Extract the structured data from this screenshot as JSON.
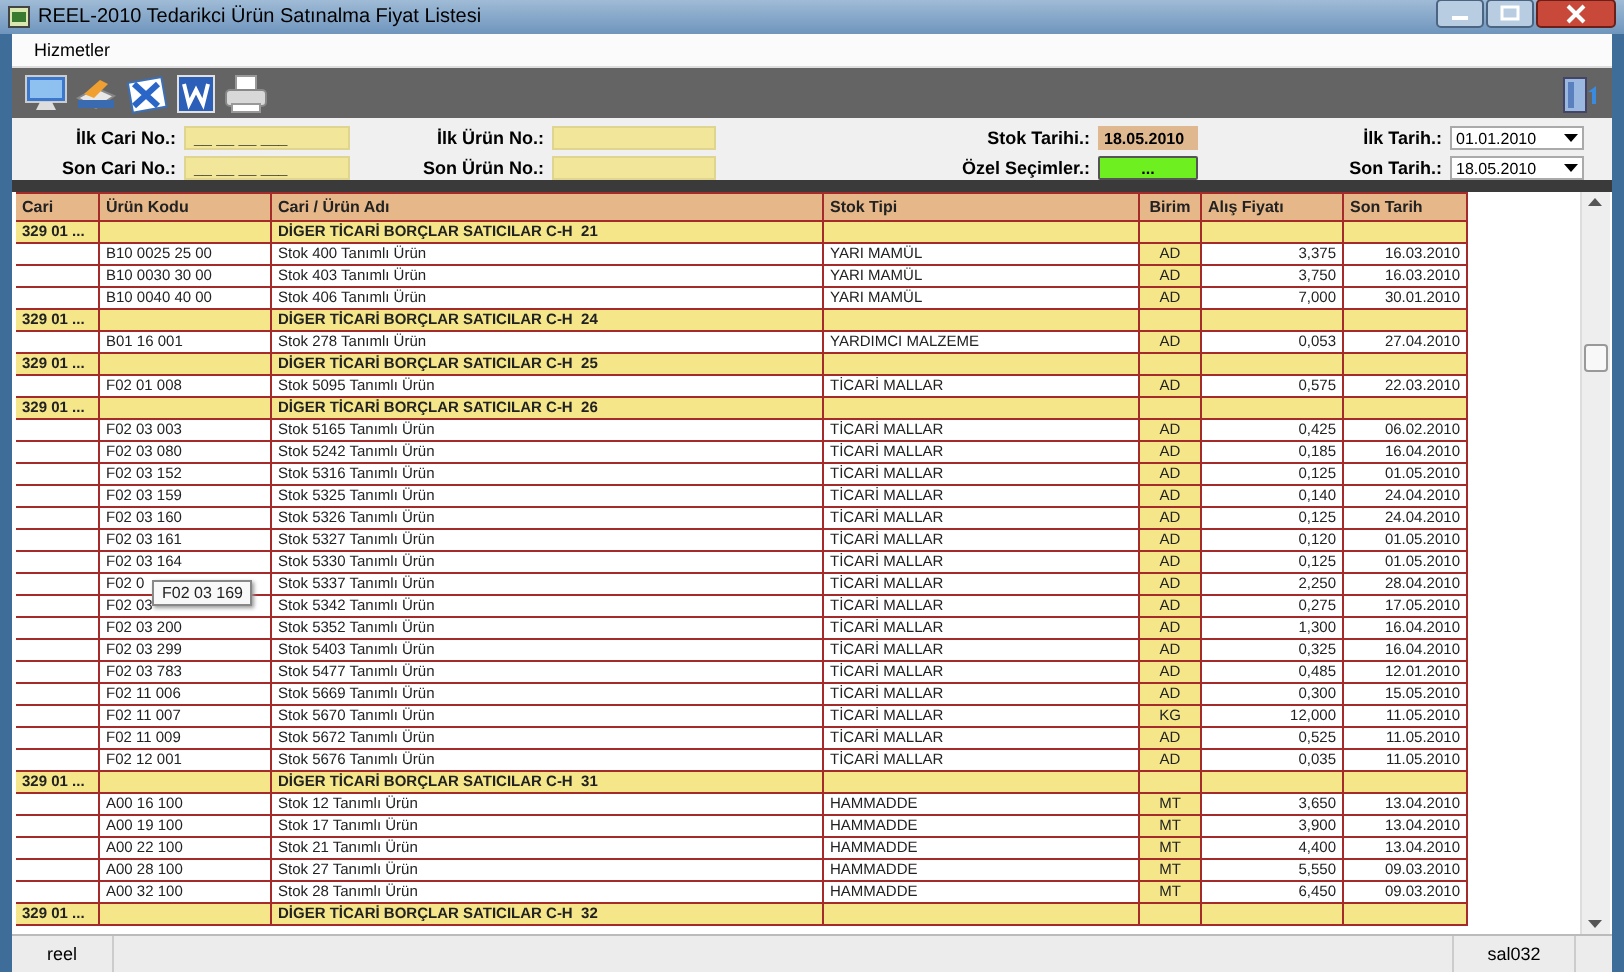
{
  "window": {
    "title": "REEL-2010 Tedarikci Ürün Satınalma Fiyat Listesi"
  },
  "menu": [
    "Hizmetler"
  ],
  "filters": {
    "left": [
      {
        "label": "İlk Cari No.:",
        "value": "__ __ __ ___"
      },
      {
        "label": "Son Cari No.:",
        "value": "__ __ __ ___"
      }
    ],
    "middle": [
      {
        "label": "İlk Ürün No.:"
      },
      {
        "label": "Son Ürün No.:"
      }
    ],
    "stock_date": {
      "label": "Stok Tarihi.:",
      "value": "18.05.2010"
    },
    "special": {
      "label": "Özel Seçimler.:",
      "button": "..."
    },
    "dates": [
      {
        "label": "İlk Tarih.:",
        "value": "01.01.2010"
      },
      {
        "label": "Son Tarih.:",
        "value": "18.05.2010"
      }
    ]
  },
  "table": {
    "columns": [
      "Cari",
      "Ürün Kodu",
      "Cari / Ürün Adı",
      "Stok Tipi",
      "Birim",
      "Alış Fiyatı",
      "Son Tarih"
    ],
    "rows": [
      {
        "kind": "group",
        "cari": "329 01 ...",
        "name": "DİGER TİCARİ BORÇLAR SATICILAR C-H  21"
      },
      {
        "kind": "item",
        "code": "B10 0025 25 00",
        "name": "Stok 400 Tanımlı Ürün",
        "type": "YARI MAMÜL",
        "unit": "AD",
        "price": "3,375",
        "date": "16.03.2010"
      },
      {
        "kind": "item",
        "code": "B10 0030 30 00",
        "name": "Stok 403 Tanımlı Ürün",
        "type": "YARI MAMÜL",
        "unit": "AD",
        "price": "3,750",
        "date": "16.03.2010"
      },
      {
        "kind": "item",
        "code": "B10 0040 40 00",
        "name": "Stok 406 Tanımlı Ürün",
        "type": "YARI MAMÜL",
        "unit": "AD",
        "price": "7,000",
        "date": "30.01.2010"
      },
      {
        "kind": "group",
        "cari": "329 01 ...",
        "name": "DİGER TİCARİ BORÇLAR SATICILAR C-H  24"
      },
      {
        "kind": "item",
        "code": "B01 16 001",
        "name": "Stok 278 Tanımlı Ürün",
        "type": "YARDIMCI MALZEME",
        "unit": "AD",
        "price": "0,053",
        "date": "27.04.2010"
      },
      {
        "kind": "group",
        "cari": "329 01 ...",
        "name": "DİGER TİCARİ BORÇLAR SATICILAR C-H  25"
      },
      {
        "kind": "item",
        "code": "F02 01 008",
        "name": "Stok 5095 Tanımlı Ürün",
        "type": "TİCARİ MALLAR",
        "unit": "AD",
        "price": "0,575",
        "date": "22.03.2010"
      },
      {
        "kind": "group",
        "cari": "329 01 ...",
        "name": "DİGER TİCARİ BORÇLAR SATICILAR C-H  26"
      },
      {
        "kind": "item",
        "code": "F02 03 003",
        "name": "Stok 5165 Tanımlı Ürün",
        "type": "TİCARİ MALLAR",
        "unit": "AD",
        "price": "0,425",
        "date": "06.02.2010"
      },
      {
        "kind": "item",
        "code": "F02 03 080",
        "name": "Stok 5242 Tanımlı Ürün",
        "type": "TİCARİ MALLAR",
        "unit": "AD",
        "price": "0,185",
        "date": "16.04.2010"
      },
      {
        "kind": "item",
        "code": "F02 03 152",
        "name": "Stok 5316 Tanımlı Ürün",
        "type": "TİCARİ MALLAR",
        "unit": "AD",
        "price": "0,125",
        "date": "01.05.2010"
      },
      {
        "kind": "item",
        "code": "F02 03 159",
        "name": "Stok 5325 Tanımlı Ürün",
        "type": "TİCARİ MALLAR",
        "unit": "AD",
        "price": "0,140",
        "date": "24.04.2010"
      },
      {
        "kind": "item",
        "code": "F02 03 160",
        "name": "Stok 5326 Tanımlı Ürün",
        "type": "TİCARİ MALLAR",
        "unit": "AD",
        "price": "0,125",
        "date": "24.04.2010"
      },
      {
        "kind": "item",
        "code": "F02 03 161",
        "name": "Stok 5327 Tanımlı Ürün",
        "type": "TİCARİ MALLAR",
        "unit": "AD",
        "price": "0,120",
        "date": "01.05.2010"
      },
      {
        "kind": "item",
        "code": "F02 03 164",
        "name": "Stok 5330 Tanımlı Ürün",
        "type": "TİCARİ MALLAR",
        "unit": "AD",
        "price": "0,125",
        "date": "01.05.2010"
      },
      {
        "kind": "item",
        "code": "F02 0",
        "name": "Stok 5337 Tanımlı Ürün",
        "type": "TİCARİ MALLAR",
        "unit": "AD",
        "price": "2,250",
        "date": "28.04.2010",
        "tooltip": "F02 03 169"
      },
      {
        "kind": "item",
        "code": "F02 03",
        "name": "Stok 5342 Tanımlı Ürün",
        "type": "TİCARİ MALLAR",
        "unit": "AD",
        "price": "0,275",
        "date": "17.05.2010"
      },
      {
        "kind": "item",
        "code": "F02 03 200",
        "name": "Stok 5352 Tanımlı Ürün",
        "type": "TİCARİ MALLAR",
        "unit": "AD",
        "price": "1,300",
        "date": "16.04.2010"
      },
      {
        "kind": "item",
        "code": "F02 03 299",
        "name": "Stok 5403 Tanımlı Ürün",
        "type": "TİCARİ MALLAR",
        "unit": "AD",
        "price": "0,325",
        "date": "16.04.2010"
      },
      {
        "kind": "item",
        "code": "F02 03 783",
        "name": "Stok 5477 Tanımlı Ürün",
        "type": "TİCARİ MALLAR",
        "unit": "AD",
        "price": "0,485",
        "date": "12.01.2010"
      },
      {
        "kind": "item",
        "code": "F02 11 006",
        "name": "Stok 5669 Tanımlı Ürün",
        "type": "TİCARİ MALLAR",
        "unit": "AD",
        "price": "0,300",
        "date": "15.05.2010"
      },
      {
        "kind": "item",
        "code": "F02 11 007",
        "name": "Stok 5670 Tanımlı Ürün",
        "type": "TİCARİ MALLAR",
        "unit": "KG",
        "price": "12,000",
        "date": "11.05.2010"
      },
      {
        "kind": "item",
        "code": "F02 11 009",
        "name": "Stok 5672 Tanımlı Ürün",
        "type": "TİCARİ MALLAR",
        "unit": "AD",
        "price": "0,525",
        "date": "11.05.2010"
      },
      {
        "kind": "item",
        "code": "F02 12 001",
        "name": "Stok 5676 Tanımlı Ürün",
        "type": "TİCARİ MALLAR",
        "unit": "AD",
        "price": "0,035",
        "date": "11.05.2010"
      },
      {
        "kind": "group",
        "cari": "329 01 ...",
        "name": "DİGER TİCARİ BORÇLAR SATICILAR C-H  31"
      },
      {
        "kind": "item",
        "code": "A00 16 100",
        "name": "Stok 12 Tanımlı Ürün",
        "type": "HAMMADDE",
        "unit": "MT",
        "price": "3,650",
        "date": "13.04.2010"
      },
      {
        "kind": "item",
        "code": "A00 19 100",
        "name": "Stok 17 Tanımlı Ürün",
        "type": "HAMMADDE",
        "unit": "MT",
        "price": "3,900",
        "date": "13.04.2010"
      },
      {
        "kind": "item",
        "code": "A00 22 100",
        "name": "Stok 21 Tanımlı Ürün",
        "type": "HAMMADDE",
        "unit": "MT",
        "price": "4,400",
        "date": "13.04.2010"
      },
      {
        "kind": "item",
        "code": "A00 28 100",
        "name": "Stok 27 Tanımlı Ürün",
        "type": "HAMMADDE",
        "unit": "MT",
        "price": "5,550",
        "date": "09.03.2010"
      },
      {
        "kind": "item",
        "code": "A00 32 100",
        "name": "Stok 28 Tanımlı Ürün",
        "type": "HAMMADDE",
        "unit": "MT",
        "price": "6,450",
        "date": "09.03.2010"
      },
      {
        "kind": "group",
        "cari": "329 01 ...",
        "name": "DİGER TİCARİ BORÇLAR SATICILAR C-H  32"
      }
    ]
  },
  "status_bar": [
    "reel",
    "sal032"
  ]
}
